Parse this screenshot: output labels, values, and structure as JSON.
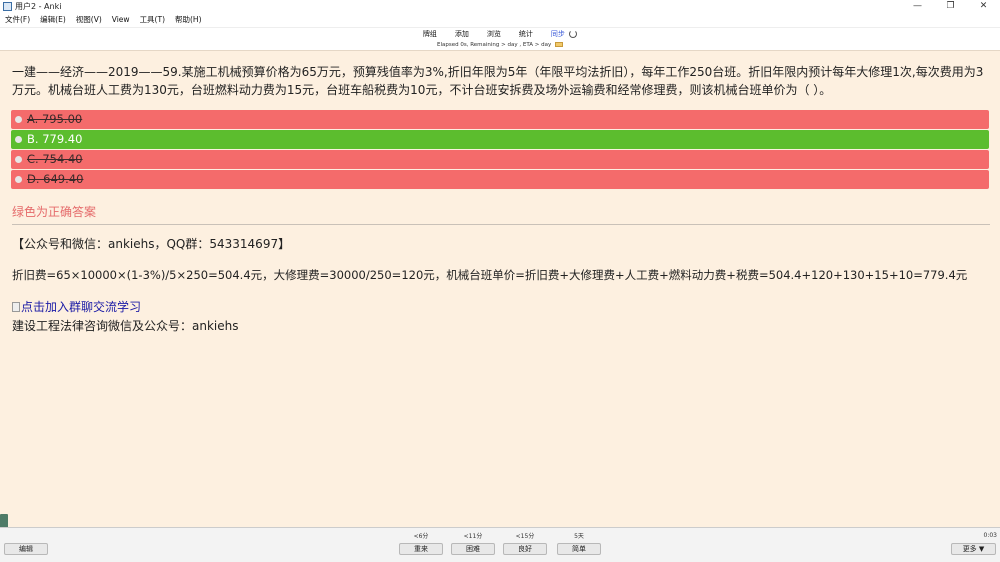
{
  "window": {
    "title": "用户2 - Anki",
    "controls": [
      "—",
      "❐",
      "✕"
    ]
  },
  "menu": [
    "文件(F)",
    "编辑(E)",
    "视图(V)",
    "View",
    "工具(T)",
    "帮助(H)"
  ],
  "toolbar": {
    "items": [
      "牌组",
      "添加",
      "浏览",
      "统计"
    ],
    "sync_label": "同步"
  },
  "progress_text": "Elapsed 0s, Remaining > day , ETA > day",
  "card": {
    "question": "一建——经济——2019——59.某施工机械预算价格为65万元，预算残值率为3%,折旧年限为5年（年限平均法折旧），每年工作250台班。折旧年限内预计每年大修理1次,每次费用为3万元。机械台班人工费为130元，台班燃料动力费为15元，台班车船税费为10元，不计台班安拆费及场外运输费和经常修理费，则该机械台班单价为（ ）。",
    "options": [
      {
        "label": "A. 795.00",
        "state": "wrong"
      },
      {
        "label": "B. 779.40",
        "state": "correct"
      },
      {
        "label": "C. 754.40",
        "state": "wrong"
      },
      {
        "label": "D. 649.40",
        "state": "wrong"
      }
    ],
    "hint": "绿色为正确答案",
    "contact": "【公众号和微信：ankiehs，QQ群：543314697】",
    "explanation": "折旧费=65×10000×(1-3%)/5×250=504.4元，大修理费=30000/250=120元，机械台班单价=折旧费+大修理费+人工费+燃料动力费+税费=504.4+120+130+15+10=779.4元",
    "join_link": "点击加入群聊交流学习",
    "footer": "建设工程法律咨询微信及公众号：ankiehs"
  },
  "bottom": {
    "edit_label": "编辑",
    "answers": [
      {
        "label": "重来",
        "interval": "<6分"
      },
      {
        "label": "困难",
        "interval": "<11分"
      },
      {
        "label": "良好",
        "interval": "<15分"
      },
      {
        "label": "简单",
        "interval": "5天"
      }
    ],
    "more_label": "更多 ▼",
    "timer": "0:03"
  },
  "colors": {
    "card_bg": "#fdf0e0",
    "wrong": "#f46b6b",
    "correct": "#5cbd2e",
    "hint": "#e56a6a",
    "link": "#1a1aa6"
  }
}
